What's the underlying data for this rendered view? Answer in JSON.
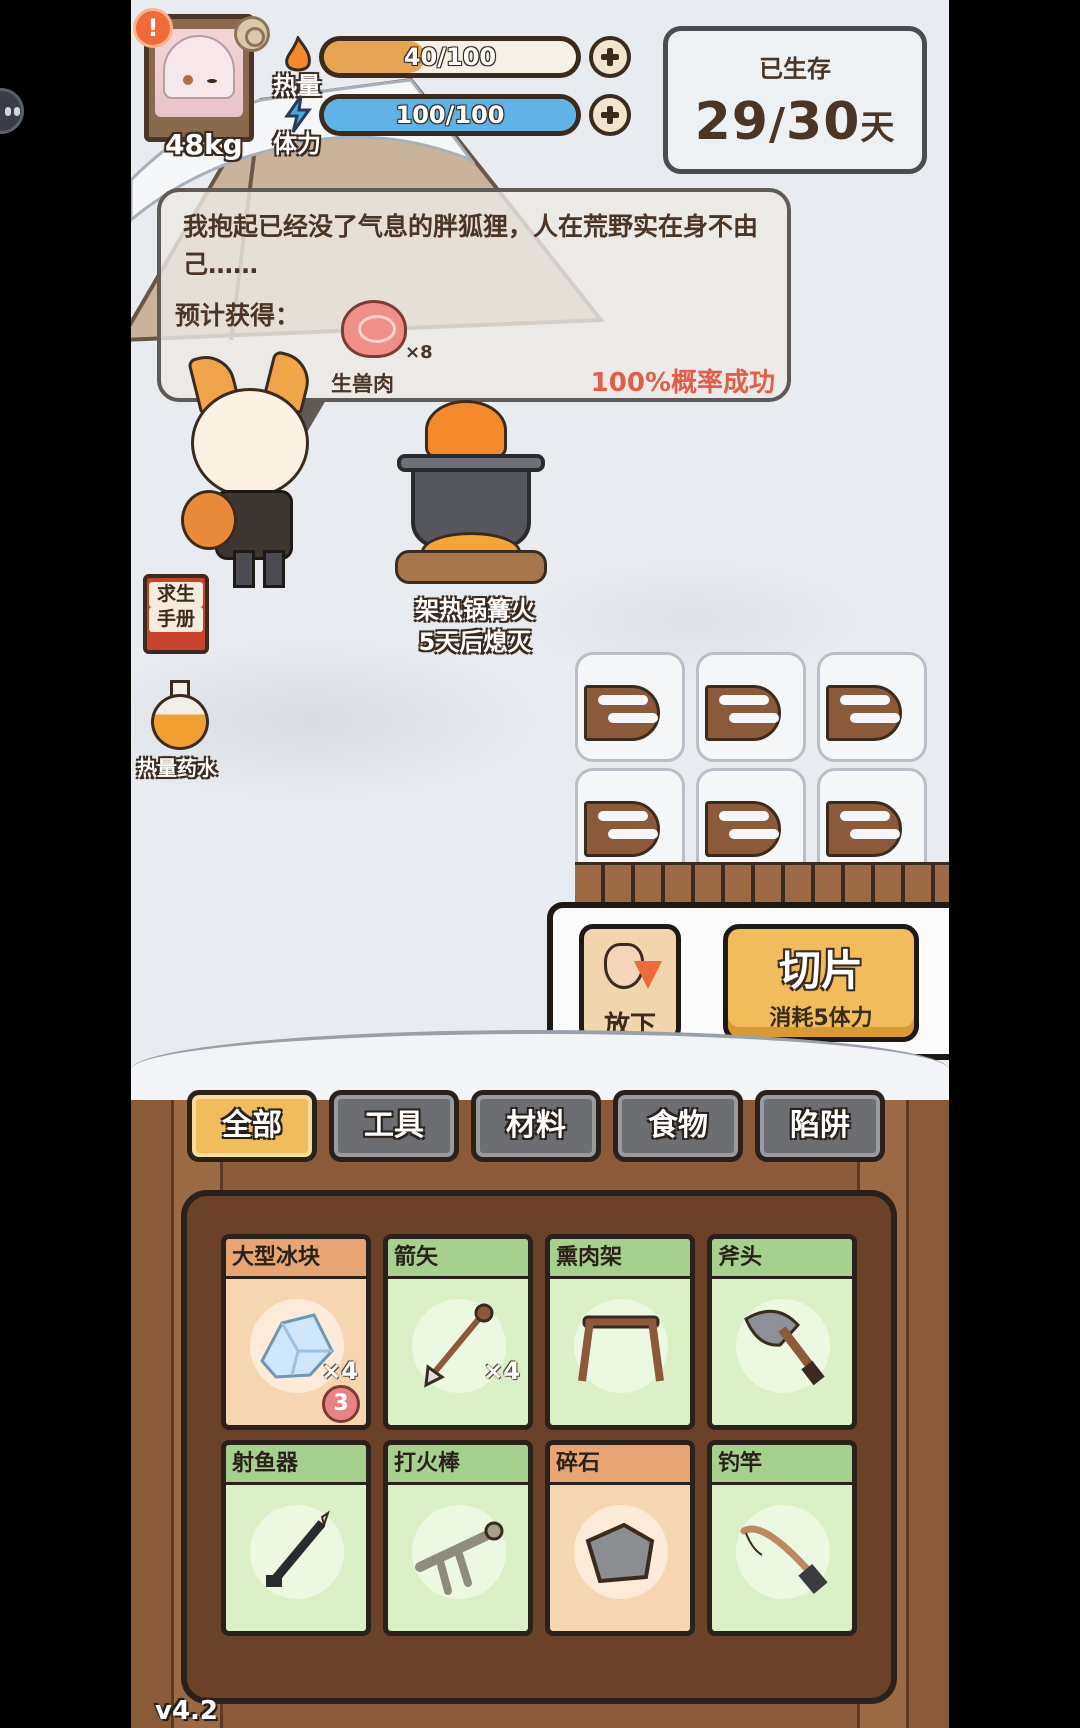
{
  "status": {
    "weight": "48kg",
    "alert_symbol": "!",
    "heat": {
      "label": "热量",
      "value_text": "40/100",
      "fraction": 0.4,
      "color": "#e7a553"
    },
    "stamina": {
      "label": "体力",
      "value_text": "100/100",
      "fraction": 1.0,
      "color": "#5fb3e6"
    }
  },
  "survived": {
    "label": "已生存",
    "current": "29",
    "separator": "/",
    "total": "30",
    "unit": "天"
  },
  "dialog": {
    "message": "我抱起已经没了气息的胖狐狸，人在荒野实在身不由己……",
    "expect_label": "预计获得：",
    "reward": {
      "name": "生兽肉",
      "count": "×8",
      "icon": "raw-meat-icon"
    },
    "success_rate": "100%概率成功"
  },
  "campfire": {
    "line1": "架热锅篝火",
    "line2": "5天后熄灭"
  },
  "side_items": {
    "manual": {
      "line1": "求生",
      "line2": "手册"
    },
    "potion": "热量药水"
  },
  "action": {
    "drop_label": "放下",
    "slice_label": "切片",
    "slice_cost": "消耗5体力"
  },
  "tabs": [
    {
      "label": "全部",
      "active": true
    },
    {
      "label": "工具",
      "active": false
    },
    {
      "label": "材料",
      "active": false
    },
    {
      "label": "食物",
      "active": false
    },
    {
      "label": "陷阱",
      "active": false
    }
  ],
  "inventory": [
    {
      "name": "大型冰块",
      "count": "×4",
      "badge": "3",
      "style": "orange",
      "icon": "ice-block-icon"
    },
    {
      "name": "箭矢",
      "count": "×4",
      "badge": "",
      "style": "green",
      "icon": "arrow-icon"
    },
    {
      "name": "熏肉架",
      "count": "",
      "badge": "",
      "style": "green",
      "icon": "smoking-rack-icon"
    },
    {
      "name": "斧头",
      "count": "",
      "badge": "",
      "style": "green",
      "icon": "axe-icon"
    },
    {
      "name": "射鱼器",
      "count": "",
      "badge": "",
      "style": "green",
      "icon": "fish-spear-icon"
    },
    {
      "name": "打火棒",
      "count": "",
      "badge": "",
      "style": "green",
      "icon": "fire-starter-icon"
    },
    {
      "name": "碎石",
      "count": "",
      "badge": "",
      "style": "orange",
      "icon": "rock-icon"
    },
    {
      "name": "钓竿",
      "count": "",
      "badge": "",
      "style": "green",
      "icon": "fishing-rod-icon"
    }
  ],
  "version": "v4.2"
}
